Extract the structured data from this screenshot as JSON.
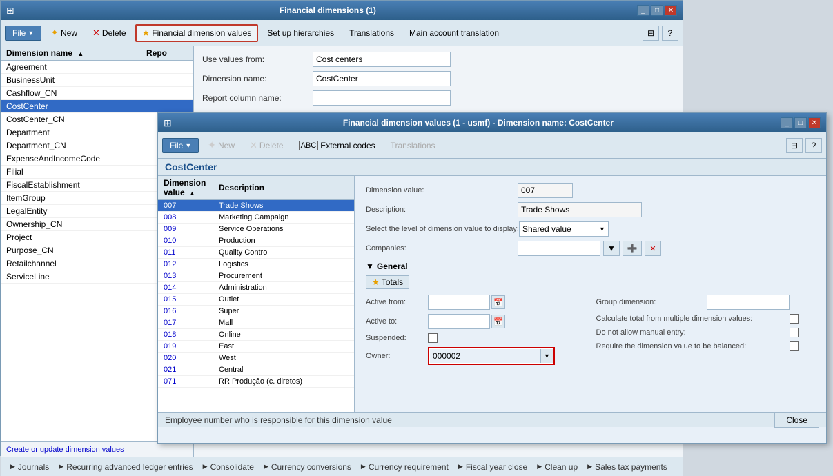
{
  "mainWindow": {
    "title": "Financial dimensions (1)",
    "titleBarBtns": [
      "_",
      "□",
      "✕"
    ]
  },
  "mainToolbar": {
    "fileLabel": "File",
    "newLabel": "New",
    "deleteLabel": "Delete",
    "financialDimValuesLabel": "Financial dimension values",
    "setupHierarchiesLabel": "Set up hierarchies",
    "translationsLabel": "Translations",
    "mainAccountTransLabel": "Main account translation"
  },
  "listHeader": {
    "col1": "Dimension name",
    "col2": "Repo",
    "sortArrow": "▲"
  },
  "dimensionList": [
    {
      "name": "Agreement",
      "repo": ""
    },
    {
      "name": "BusinessUnit",
      "repo": ""
    },
    {
      "name": "Cashflow_CN",
      "repo": ""
    },
    {
      "name": "CostCenter",
      "repo": "",
      "selected": true
    },
    {
      "name": "CostCenter_CN",
      "repo": ""
    },
    {
      "name": "Department",
      "repo": ""
    },
    {
      "name": "Department_CN",
      "repo": ""
    },
    {
      "name": "ExpenseAndIncomeCode",
      "repo": ""
    },
    {
      "name": "Filial",
      "repo": ""
    },
    {
      "name": "FiscalEstablishment",
      "repo": ""
    },
    {
      "name": "ItemGroup",
      "repo": ""
    },
    {
      "name": "LegalEntity",
      "repo": ""
    },
    {
      "name": "Ownership_CN",
      "repo": ""
    },
    {
      "name": "Project",
      "repo": ""
    },
    {
      "name": "Purpose_CN",
      "repo": ""
    },
    {
      "name": "Retailchannel",
      "repo": ""
    },
    {
      "name": "ServiceLine",
      "repo": ""
    }
  ],
  "formFields": {
    "useValuesFromLabel": "Use values from:",
    "useValuesFromValue": "Cost centers",
    "dimensionNameLabel": "Dimension name:",
    "dimensionNameValue": "CostCenter",
    "reportColumnNameLabel": "Report column name:"
  },
  "createUpdateBtn": "Create or update dimension values",
  "bottomNav": [
    {
      "label": "Journals"
    },
    {
      "label": "Recurring advanced ledger entries"
    },
    {
      "label": "Consolidate"
    },
    {
      "label": "Currency conversions"
    },
    {
      "label": "Currency requirement"
    },
    {
      "label": "Fiscal year close"
    },
    {
      "label": "Clean up"
    },
    {
      "label": "Sales tax payments"
    }
  ],
  "secondWindow": {
    "title": "Financial dimension values (1 - usmf) - Dimension name: CostCenter",
    "titleBarBtns": [
      "_",
      "□",
      "✕"
    ]
  },
  "secondToolbar": {
    "fileLabel": "File",
    "newLabel": "New",
    "deleteLabel": "Delete",
    "externalCodesLabel": "External codes",
    "translationsLabel": "Translations"
  },
  "costCenterTitle": "CostCenter",
  "dimValueListHeader": {
    "col1": "Dimension value",
    "col2": "Description",
    "sortArrow": "▲"
  },
  "dimValueRows": [
    {
      "code": "007",
      "desc": "Trade Shows",
      "selected": true
    },
    {
      "code": "008",
      "desc": "Marketing Campaign"
    },
    {
      "code": "009",
      "desc": "Service Operations"
    },
    {
      "code": "010",
      "desc": "Production"
    },
    {
      "code": "011",
      "desc": "Quality Control"
    },
    {
      "code": "012",
      "desc": "Logistics"
    },
    {
      "code": "013",
      "desc": "Procurement"
    },
    {
      "code": "014",
      "desc": "Administration"
    },
    {
      "code": "015",
      "desc": "Outlet"
    },
    {
      "code": "016",
      "desc": "Super"
    },
    {
      "code": "017",
      "desc": "Mall"
    },
    {
      "code": "018",
      "desc": "Online"
    },
    {
      "code": "019",
      "desc": "East"
    },
    {
      "code": "020",
      "desc": "West"
    },
    {
      "code": "021",
      "desc": "Central"
    },
    {
      "code": "071",
      "desc": "RR Produção (c. diretos)"
    }
  ],
  "dvForm": {
    "dimensionValueLabel": "Dimension value:",
    "dimensionValueVal": "007",
    "descriptionLabel": "Description:",
    "descriptionVal": "Trade Shows",
    "selectLevelLabel": "Select the level of dimension value to display:",
    "selectLevelVal": "Shared value",
    "companiesLabel": "Companies:",
    "generalLabel": "General",
    "totalsLabel": "Totals",
    "activeFromLabel": "Active from:",
    "activeToLabel": "Active to:",
    "suspendedLabel": "Suspended:",
    "ownerLabel": "Owner:",
    "ownerVal": "000002",
    "groupDimensionLabel": "Group dimension:",
    "groupDimensionVal": "",
    "calcTotalLabel": "Calculate total from multiple dimension values:",
    "doNotAllowLabel": "Do not allow manual entry:",
    "requireBalancedLabel": "Require the dimension value to be balanced:"
  },
  "statusBar": {
    "text": "Employee number who is responsible for this dimension value",
    "closeLabel": "Close"
  },
  "colors": {
    "selectedBg": "#316ac5",
    "headerBg": "#dce8f0",
    "windowBg": "#e8f0f8",
    "accentBlue": "#4a7fb5",
    "redBorder": "#cc0000",
    "titleBarGrad1": "#4a7fb5",
    "titleBarGrad2": "#2d5f8a"
  }
}
